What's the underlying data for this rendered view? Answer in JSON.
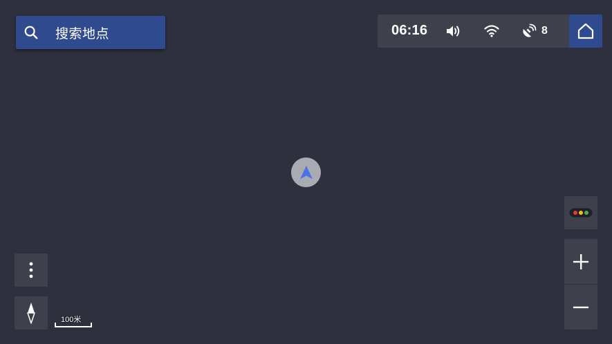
{
  "search": {
    "placeholder": "搜索地点"
  },
  "status_bar": {
    "time": "06:16",
    "gps_satellite_count": "8",
    "icons": [
      "volume-icon",
      "wifi-icon",
      "gps-satellite-icon"
    ]
  },
  "home_button": {
    "icon": "home-icon"
  },
  "map": {
    "scale_label": "100米",
    "location_marker_icon": "navigation-arrow-icon"
  },
  "controls": {
    "traffic_icon": "traffic-light-icon",
    "zoom_in_icon": "plus-icon",
    "zoom_out_icon": "minus-icon",
    "more_icon": "more-vertical-icon",
    "compass_icon": "compass-icon"
  },
  "colors": {
    "background": "#2e303d",
    "panel": "#3e414c",
    "accent": "#2f4a8f",
    "marker_arrow": "#4a72e8",
    "traffic_red": "#e53935",
    "traffic_yellow": "#f4c20d",
    "traffic_green": "#4caf50"
  }
}
